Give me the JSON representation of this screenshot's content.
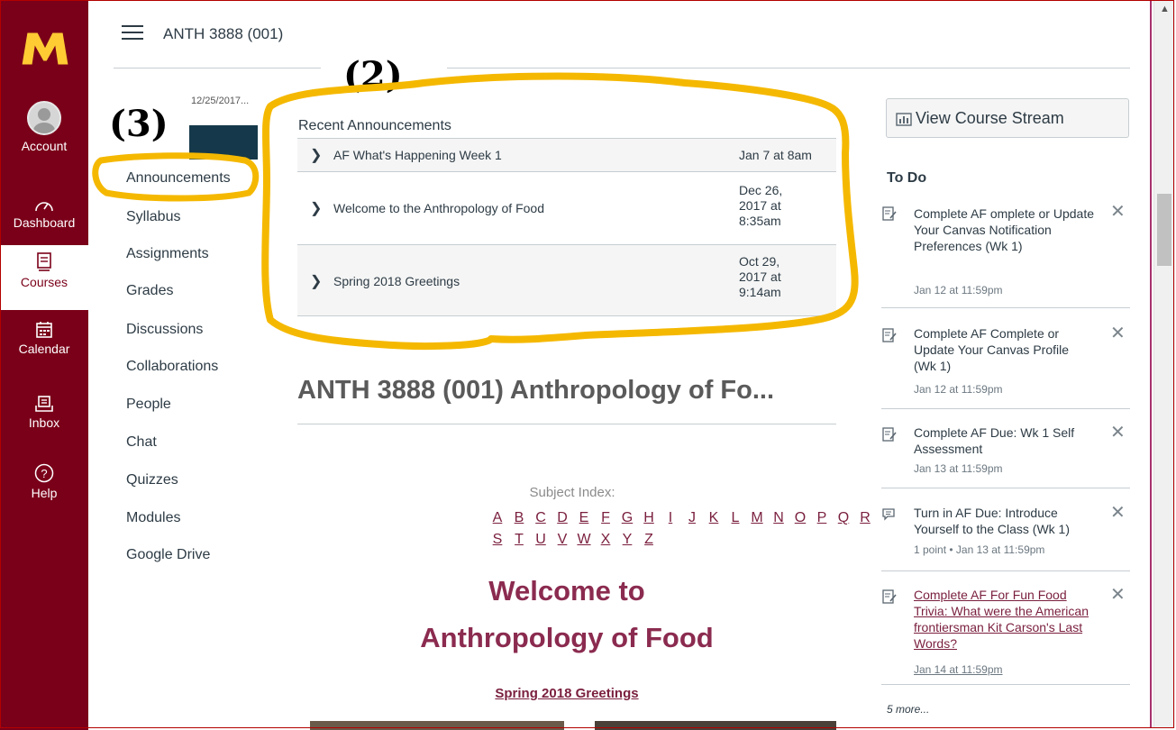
{
  "header": {
    "course_title": "ANTH 3888 (001)"
  },
  "global_nav": {
    "items": [
      {
        "label": "Account",
        "icon": "avatar-icon"
      },
      {
        "label": "Dashboard",
        "icon": "dashboard-icon"
      },
      {
        "label": "Courses",
        "icon": "courses-icon"
      },
      {
        "label": "Calendar",
        "icon": "calendar-icon"
      },
      {
        "label": "Inbox",
        "icon": "inbox-icon"
      },
      {
        "label": "Help",
        "icon": "help-icon"
      }
    ]
  },
  "annotations": {
    "left": "(3)",
    "top": "(2)"
  },
  "course_nav": {
    "date_crumb": "12/25/2017...",
    "items": [
      "Announcements",
      "Syllabus",
      "Assignments",
      "Grades",
      "Discussions",
      "Collaborations",
      "People",
      "Chat",
      "Quizzes",
      "Modules",
      "Google Drive"
    ]
  },
  "recent_announcements": {
    "title": "Recent Announcements",
    "items": [
      {
        "title": "AF What's Happening Week 1",
        "date": "Jan 7 at 8am"
      },
      {
        "title": "Welcome to the Anthropology of Food",
        "date": "Dec 26, 2017 at 8:35am"
      },
      {
        "title": "Spring 2018 Greetings",
        "date": "Oct 29, 2017 at 9:14am"
      }
    ]
  },
  "main": {
    "course_heading": "ANTH 3888 (001) Anthropology of Fo...",
    "subject_index_label": "Subject Index:",
    "letters_row1": [
      "A",
      "B",
      "C",
      "D",
      "E",
      "F",
      "G",
      "H",
      "I",
      "J",
      "K",
      "L",
      "M",
      "N",
      "O",
      "P",
      "Q",
      "R"
    ],
    "letters_row2": [
      "S",
      "T",
      "U",
      "V",
      "W",
      "X",
      "Y",
      "Z"
    ],
    "welcome_line1": "Welcome to",
    "welcome_line2": "Anthropology of Food",
    "greetings_link": "Spring 2018 Greetings"
  },
  "sidebar": {
    "view_stream": "View Course Stream",
    "todo_title": "To Do",
    "todos": [
      {
        "title": "Complete AF omplete or Update Your Canvas Notification Preferences (Wk 1)",
        "meta": "Jan 12 at 11:59pm",
        "icon": "quiz-icon"
      },
      {
        "title": "Complete AF Complete or Update Your Canvas Profile (Wk 1)",
        "meta": "Jan 12 at 11:59pm",
        "icon": "quiz-icon"
      },
      {
        "title": "Complete AF Due: Wk 1 Self Assessment",
        "meta": "Jan 13 at 11:59pm",
        "icon": "quiz-icon"
      },
      {
        "title": "Turn in AF Due: Introduce Yourself to the Class (Wk 1)",
        "meta": "1 point • Jan 13 at 11:59pm",
        "icon": "discussion-icon"
      },
      {
        "title": "Complete AF For Fun Food Trivia: What were the American frontiersman Kit Carson's Last Words?",
        "meta": "Jan 14 at 11:59pm",
        "icon": "quiz-icon"
      }
    ],
    "more": "5 more..."
  },
  "colors": {
    "brand": "#7a0019",
    "accent": "#7a1f3d",
    "highlight": "#f5b800"
  }
}
